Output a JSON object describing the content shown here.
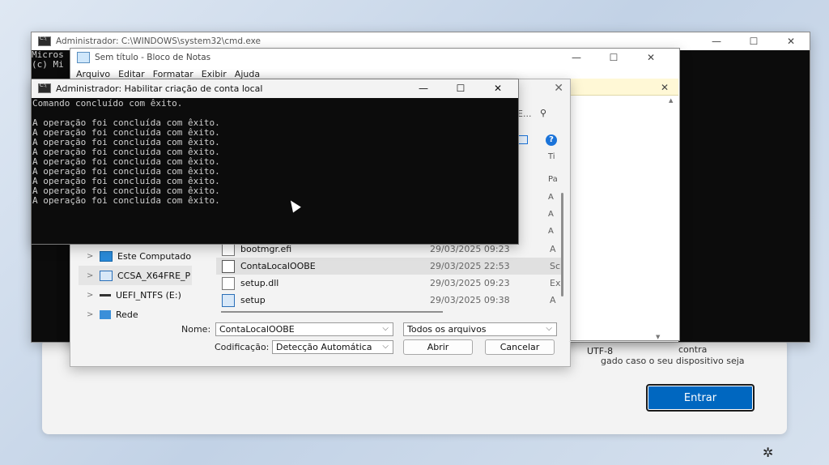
{
  "cmd_main": {
    "title": "Administrador: C:\\WINDOWS\\system32\\cmd.exe",
    "lines": [
      "Micros",
      "(c) Mi"
    ]
  },
  "notepad": {
    "title": "Sem título - Bloco de Notas",
    "menu": [
      "Arquivo",
      "Editar",
      "Formatar",
      "Exibir",
      "Ajuda"
    ],
    "encoding_status": "UTF-8"
  },
  "dialog": {
    "search_placeholder": "E...",
    "right_column": [
      "Ti",
      "Pa",
      "A",
      "A",
      "A",
      "A",
      "Sc",
      "Ex",
      "A"
    ],
    "tree": [
      {
        "label": "Este Computado",
        "icon": "monitor-icon"
      },
      {
        "label": "CCSA_X64FRE_P",
        "icon": "drive-icon"
      },
      {
        "label": "UEFI_NTFS (E:)",
        "icon": "drive-icon"
      },
      {
        "label": "Rede",
        "icon": "network-icon"
      }
    ],
    "files": [
      {
        "name": "bootmgr.efi",
        "date": "29/03/2025 09:23",
        "type": "A"
      },
      {
        "name": "ContaLocalOOBE",
        "date": "29/03/2025 22:53",
        "type": "Sc"
      },
      {
        "name": "setup.dll",
        "date": "29/03/2025 09:23",
        "type": "Ex"
      },
      {
        "name": "setup",
        "date": "29/03/2025 09:38",
        "type": "A"
      }
    ],
    "name_label": "Nome:",
    "name_value": "ContaLocalOOBE",
    "filter_value": "Todos os arquivos",
    "encoding_label": "Codificação:",
    "encoding_value": "Detecção Automática",
    "open_button": "Abrir",
    "cancel_button": "Cancelar"
  },
  "cmd_small": {
    "title": "Administrador:  Habilitar criação de conta local",
    "lines": [
      "Comando concluído com êxito.",
      "",
      "A operação foi concluída com êxito.",
      "A operação foi concluída com êxito.",
      "A operação foi concluída com êxito.",
      "A operação foi concluída com êxito.",
      "A operação foi concluída com êxito.",
      "A operação foi concluída com êxito.",
      "A operação foi concluída com êxito.",
      "A operação foi concluída com êxito.",
      "A operação foi concluída com êxito."
    ]
  },
  "oobe": {
    "text_line1": "contra",
    "text_line2": "gado caso o seu dispositivo seja",
    "enter_button": "Entrar"
  },
  "colors": {
    "accent": "#0067c0",
    "console_bg": "#0c0c0c"
  }
}
